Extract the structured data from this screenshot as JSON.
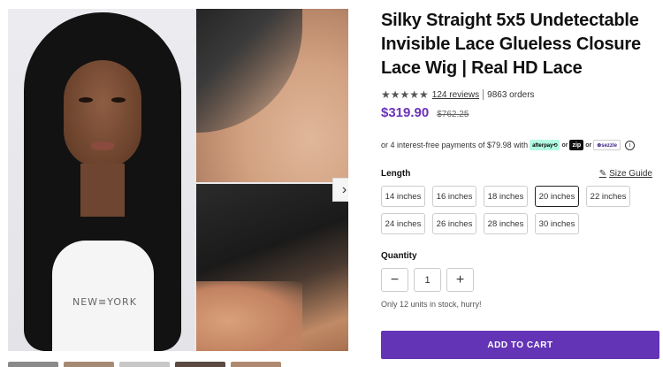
{
  "product": {
    "title": "Silky Straight 5x5 Undetectable Invisible Lace Glueless Closure Lace Wig | Real HD Lace",
    "stars": "★★★★★",
    "reviews_label": "124 reviews",
    "orders_label": "9863 orders",
    "price": "$319.90",
    "old_price": "$762.25"
  },
  "gallery": {
    "shirt_text": "NEW≡YORK",
    "next_arrow": "›"
  },
  "payment": {
    "text": "or 4 interest-free payments of $79.98 with",
    "afterpay": "afterpay⟲",
    "or1": "or",
    "zip": "zip",
    "or2": "or",
    "sezzle": "⊛sezzle",
    "info_glyph": "i"
  },
  "length": {
    "label": "Length",
    "size_guide": "Size Guide",
    "ruler_glyph": "✎",
    "options": [
      "14 inches",
      "16 inches",
      "18 inches",
      "20 inches",
      "22 inches",
      "24 inches",
      "26 inches",
      "28 inches",
      "30 inches"
    ],
    "selected": "20 inches"
  },
  "quantity": {
    "label": "Quantity",
    "minus": "−",
    "value": "1",
    "plus": "+",
    "stock_note": "Only 12 units in stock, hurry!"
  },
  "cart": {
    "button_label": "ADD TO CART"
  },
  "colors": {
    "accent": "#6434b6",
    "price": "#6b32b8"
  }
}
